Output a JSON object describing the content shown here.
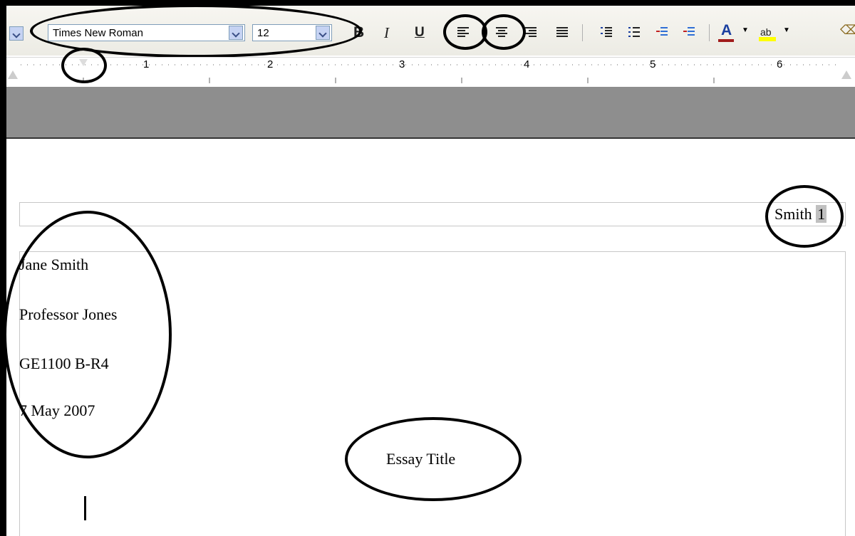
{
  "toolbar": {
    "font_name": "Times New Roman",
    "font_size": "12",
    "bold_label": "B",
    "italic_label": "I",
    "underline_label": "U",
    "font_color_label": "A",
    "highlight_label": "ab",
    "icons": [
      "style-dropdown-icon",
      "bold-icon",
      "italic-icon",
      "underline-icon",
      "align-left-icon",
      "align-center-icon",
      "align-right-icon",
      "justify-icon",
      "numbered-list-icon",
      "bullet-list-icon",
      "decrease-indent-icon",
      "increase-indent-icon",
      "font-color-icon",
      "highlight-icon",
      "eraser-icon"
    ],
    "font_color": "#a11c1c",
    "highlight_color": "#ffff00"
  },
  "ruler": {
    "numbers": [
      "1",
      "2",
      "3",
      "4",
      "5",
      "6"
    ]
  },
  "document": {
    "header_text": "Smith",
    "page_number": "1",
    "lines": [
      "Jane Smith",
      "Professor Jones",
      "GE1100 B-R4",
      "7 May 2007"
    ],
    "title": "Essay Title"
  }
}
